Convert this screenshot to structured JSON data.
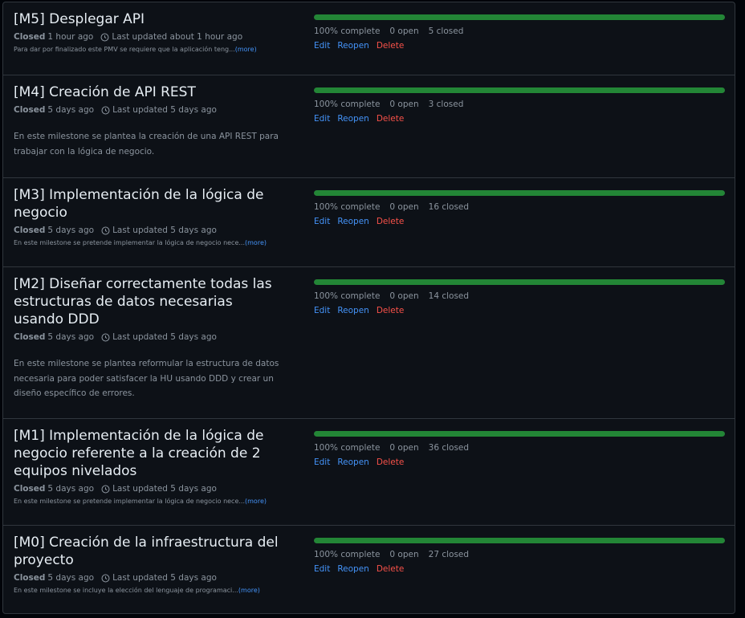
{
  "colors": {
    "accent": "#4493f8",
    "danger": "#f85149",
    "progress": "#238636"
  },
  "milestones": [
    {
      "title": "[M5] Desplegar API",
      "state": "Closed",
      "closed_ago": "1 hour ago",
      "updated": "Last updated about 1 hour ago",
      "description": "Para dar por finalizado este PMV se requiere que la aplicación teng...",
      "more": "(more)",
      "progress": 1.0,
      "complete": "100% complete",
      "open": "0 open",
      "closed": "5 closed",
      "edit": "Edit",
      "reopen": "Reopen",
      "delete": "Delete"
    },
    {
      "title": "[M4] Creación de API REST",
      "state": "Closed",
      "closed_ago": "5 days ago",
      "updated": "Last updated 5 days ago",
      "description": "En este milestone se plantea la creación de una API REST para trabajar con la lógica de negocio.",
      "progress": 1.0,
      "complete": "100% complete",
      "open": "0 open",
      "closed": "3 closed",
      "edit": "Edit",
      "reopen": "Reopen",
      "delete": "Delete"
    },
    {
      "title": "[M3] Implementación de la lógica de negocio",
      "state": "Closed",
      "closed_ago": "5 days ago",
      "updated": "Last updated 5 days ago",
      "description": "En este milestone se pretende implementar la lógica de negocio nece...",
      "more": "(more)",
      "progress": 1.0,
      "complete": "100% complete",
      "open": "0 open",
      "closed": "16 closed",
      "edit": "Edit",
      "reopen": "Reopen",
      "delete": "Delete"
    },
    {
      "title": "[M2] Diseñar correctamente todas las estructuras de datos necesarias usando DDD",
      "state": "Closed",
      "closed_ago": "5 days ago",
      "updated": "Last updated 5 days ago",
      "description": "En este milestone se plantea reformular la estructura de datos necesaria para poder satisfacer la HU usando DDD y crear un diseño específico de errores.",
      "progress": 1.0,
      "complete": "100% complete",
      "open": "0 open",
      "closed": "14 closed",
      "edit": "Edit",
      "reopen": "Reopen",
      "delete": "Delete"
    },
    {
      "title": "[M1] Implementación de la lógica de negocio referente a la creación de 2 equipos nivelados",
      "state": "Closed",
      "closed_ago": "5 days ago",
      "updated": "Last updated 5 days ago",
      "description": "En este milestone se pretende implementar la lógica de negocio nece...",
      "more": "(more)",
      "progress": 1.0,
      "complete": "100% complete",
      "open": "0 open",
      "closed": "36 closed",
      "edit": "Edit",
      "reopen": "Reopen",
      "delete": "Delete"
    },
    {
      "title": "[M0] Creación de la infraestructura del proyecto",
      "state": "Closed",
      "closed_ago": "5 days ago",
      "updated": "Last updated 5 days ago",
      "description": "En este milestone se incluye la elección del lenguaje de programaci...",
      "more": "(more)",
      "progress": 1.0,
      "complete": "100% complete",
      "open": "0 open",
      "closed": "27 closed",
      "edit": "Edit",
      "reopen": "Reopen",
      "delete": "Delete"
    }
  ]
}
